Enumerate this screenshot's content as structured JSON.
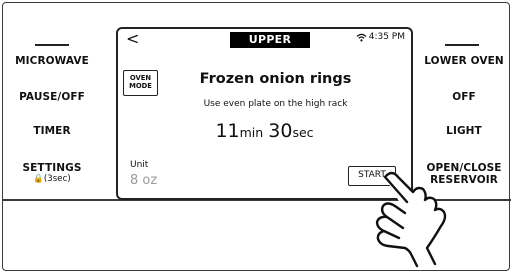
{
  "left_buttons": {
    "microwave": "MICROWAVE",
    "pause_off": "PAUSE/OFF",
    "timer": "TIMER",
    "settings": "SETTINGS",
    "settings_sub": "🔒(3sec)"
  },
  "right_buttons": {
    "lower_oven": "LOWER OVEN",
    "off": "OFF",
    "light": "LIGHT",
    "open_close_line1": "OPEN/CLOSE",
    "open_close_line2": "RESERVOIR"
  },
  "screen": {
    "back_glyph": "<",
    "title": "UPPER",
    "wifi_icon": "wifi-icon",
    "clock": "4:35 PM",
    "oven_mode_line1": "OVEN",
    "oven_mode_line2": "MODE",
    "food_name": "Frozen onion rings",
    "instruction": "Use even plate on the high rack",
    "time_minutes": "11",
    "time_min_unit": "min",
    "time_seconds": "30",
    "time_sec_unit": "sec",
    "unit_label": "Unit",
    "unit_value": "8 oz",
    "start_label": "START"
  },
  "colors": {
    "border": "#222222",
    "title_bg": "#000000",
    "title_text": "#ffffff",
    "unit_value": "#9a9a9a"
  }
}
